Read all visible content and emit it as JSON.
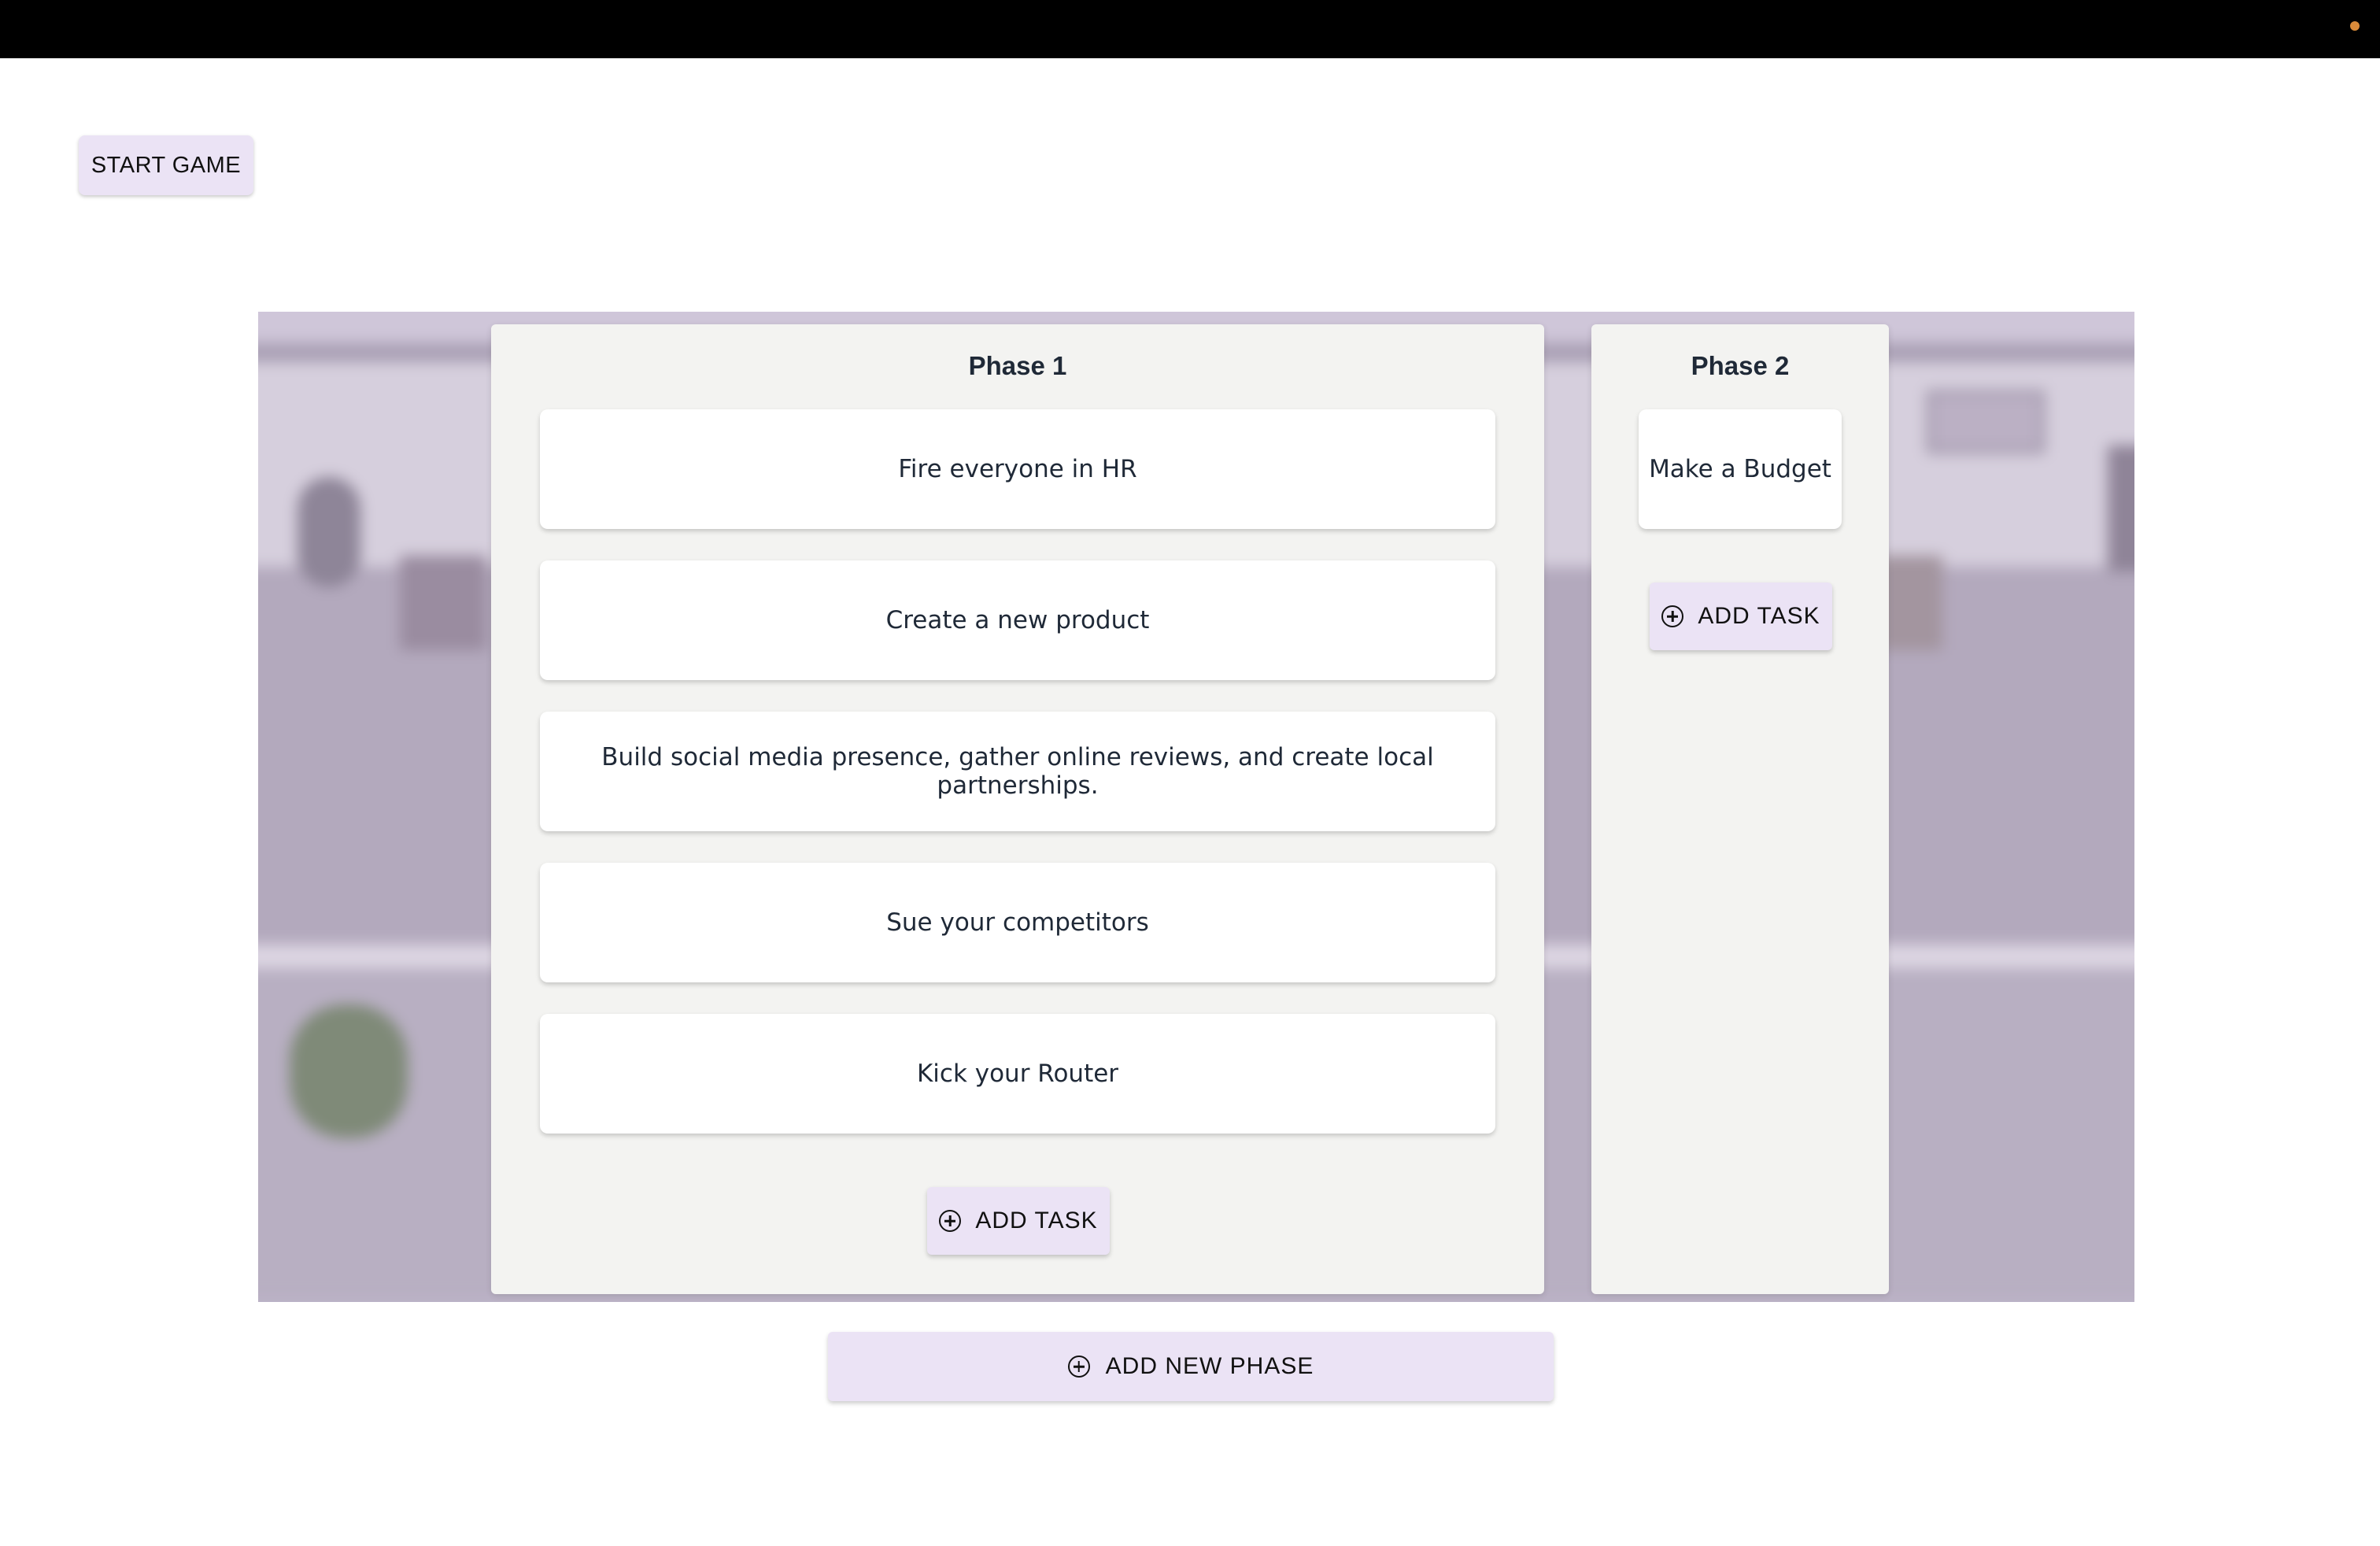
{
  "toolbar": {
    "start_label": "START GAME"
  },
  "phases": [
    {
      "title": "Phase 1",
      "tasks": [
        "Fire everyone in HR",
        "Create a new product",
        "Build social media presence, gather online reviews, and create local partnerships.",
        "Sue your competitors",
        "Kick your Router"
      ],
      "add_task_label": "ADD TASK"
    },
    {
      "title": "Phase 2",
      "tasks": [
        "Make a Budget"
      ],
      "add_task_label": "ADD TASK"
    }
  ],
  "add_phase_label": "ADD NEW PHASE",
  "colors": {
    "button_bg": "#ebe3f5",
    "phase_bg": "#f3f3f1",
    "topbar": "#000000",
    "status_dot": "#d98a3a"
  }
}
